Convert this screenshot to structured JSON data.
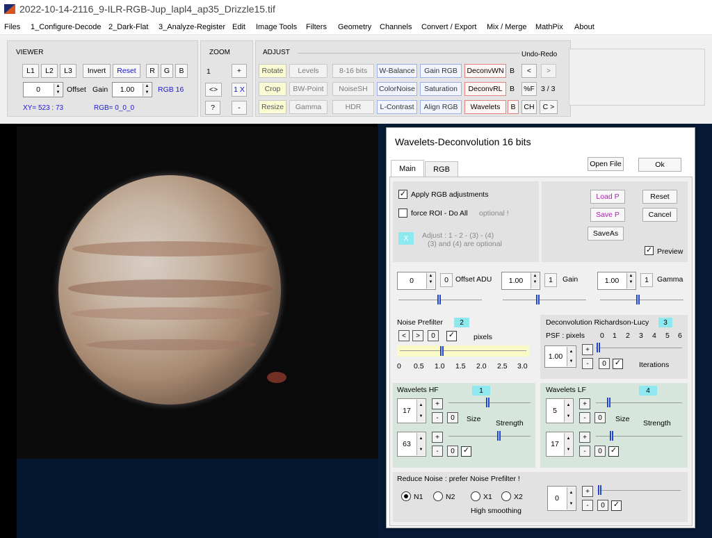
{
  "window": {
    "title": "2022-10-14-2116_9-ILR-RGB-Jup_lapl4_ap35_Drizzle15.tif"
  },
  "menu": [
    "Files",
    "1_Configure-Decode",
    "2_Dark-Flat",
    "3_Analyze-Register",
    "Edit",
    "Image Tools",
    "Filters",
    "Geometry",
    "Channels",
    "Convert / Export",
    "Mix / Merge",
    "MathPix",
    "About"
  ],
  "viewer": {
    "title": "VIEWER",
    "buttons": [
      "L1",
      "L2",
      "L3",
      "Invert",
      "Reset",
      "R",
      "G",
      "B"
    ],
    "offset_value": "0",
    "offset_label": "Offset",
    "gain_label": "Gain",
    "gain_value": "1.00",
    "rgb_mode": "RGB 16",
    "xy_readout": "XY=  523 : 73",
    "rgb_readout": "RGB=  0_0_0"
  },
  "zoom": {
    "title": "ZOOM",
    "level": "1",
    "plus": "+",
    "fit": "<>",
    "one_x": "1 X",
    "help": "?",
    "minus": "-"
  },
  "adjust": {
    "title": "ADJUST",
    "row1": [
      "Rotate",
      "Levels",
      "8-16 bits",
      "W-Balance",
      "Gain RGB",
      "DeconvWN"
    ],
    "row2": [
      "Crop",
      "BW-Point",
      "NoiseSH",
      "ColorNoise",
      "Saturation",
      "DeconvRL"
    ],
    "row3": [
      "Resize",
      "Gamma",
      "HDR",
      "L-Contrast",
      "Align RGB",
      "Wavelets"
    ],
    "b_label": "B",
    "undo_title": "Undo-Redo",
    "undo": "<",
    "redo": ">",
    "pct_f": "%F",
    "count": "3 / 3",
    "ch": "CH",
    "c_next": "C >"
  },
  "dialog": {
    "title": "Wavelets-Deconvolution 16 bits",
    "tabs": [
      "Main",
      "RGB"
    ],
    "open_file": "Open File",
    "ok": "Ok",
    "apply_rgb": "Apply RGB adjustments",
    "force_roi": "force ROI - Do All",
    "optional": "optional !",
    "x_badge": "X",
    "adjust_line1": "Adjust :  1 - 2 - (3) - (4)",
    "adjust_line2": "(3) and (4) are optional",
    "load_p": "Load P",
    "save_p": "Save P",
    "save_as": "SaveAs",
    "reset": "Reset",
    "cancel": "Cancel",
    "preview": "Preview",
    "offset": {
      "value": "0",
      "reset": "0",
      "label": "Offset ADU"
    },
    "gain": {
      "value": "1.00",
      "reset": "1",
      "label": "Gain"
    },
    "gamma": {
      "value": "1.00",
      "reset": "1",
      "label": "Gamma"
    },
    "noise_prefilter": {
      "title": "Noise Prefilter",
      "badge": "2",
      "prev": "<",
      "next": ">",
      "zero": "0",
      "unit": "pixels",
      "ticks": [
        "0",
        "0.5",
        "1.0",
        "1.5",
        "2.0",
        "2.5",
        "3.0"
      ],
      "value_fraction": 0.33
    },
    "deconv_rl": {
      "title": "Deconvolution Richardson-Lucy",
      "badge": "3",
      "psf_label": "PSF : pixels",
      "ticks": [
        "0",
        "1",
        "2",
        "3",
        "4",
        "5",
        "6"
      ],
      "psf_value": "1.00",
      "zero": "0",
      "iterations": "Iterations"
    },
    "wavelets_hf": {
      "title": "Wavelets HF",
      "badge": "1",
      "size_value": "17",
      "strength_value": "63",
      "size_label": "Size",
      "strength_label": "Strength",
      "zero": "0"
    },
    "wavelets_lf": {
      "title": "Wavelets LF",
      "badge": "4",
      "size_value": "5",
      "strength_value": "17",
      "size_label": "Size",
      "strength_label": "Strength",
      "zero": "0"
    },
    "reduce_noise": {
      "title": "Reduce Noise :  prefer Noise Prefilter !",
      "options": [
        "N1",
        "N2",
        "X1",
        "X2"
      ],
      "selected": "N1",
      "high_smoothing": "High smoothing",
      "value": "0",
      "zero": "0"
    }
  }
}
